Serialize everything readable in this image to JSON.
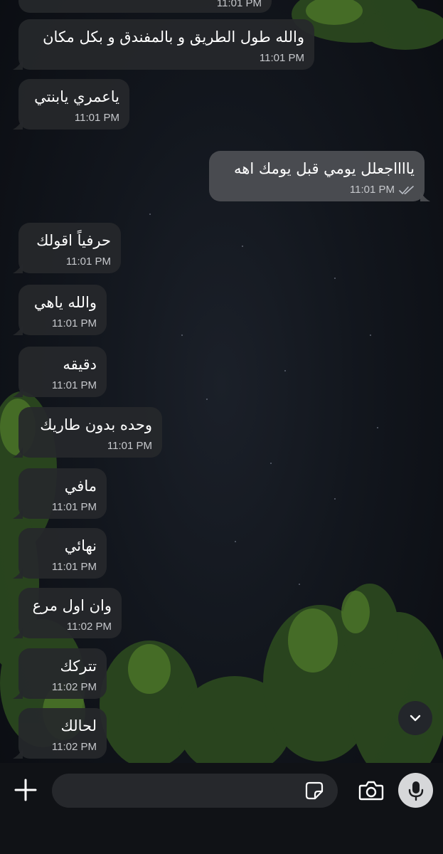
{
  "chat": {
    "top_partial_time": "11:01 PM",
    "messages": [
      {
        "direction": "in",
        "text": "والله طول الطريق و بالمفندق و بكل مكان",
        "time": "11:01 PM"
      },
      {
        "direction": "in",
        "text": "ياعمري يابنتي",
        "time": "11:01 PM"
      },
      {
        "direction": "out",
        "text": "يااااجعلل يومي قبل يومك اهه",
        "time": "11:01 PM",
        "status": "read"
      },
      {
        "direction": "in",
        "text": "حرفياً اقولك",
        "time": "11:01 PM"
      },
      {
        "direction": "in",
        "text": "والله ياهي",
        "time": "11:01 PM"
      },
      {
        "direction": "in",
        "text": "دقيقه",
        "time": "11:01 PM"
      },
      {
        "direction": "in",
        "text": "وحده بدون طاريك",
        "time": "11:01 PM"
      },
      {
        "direction": "in",
        "text": "مافي",
        "time": "11:01 PM"
      },
      {
        "direction": "in",
        "text": "نهائي",
        "time": "11:01 PM"
      },
      {
        "direction": "in",
        "text": "وان اول مرع",
        "time": "11:02 PM"
      },
      {
        "direction": "in",
        "text": "تتركك",
        "time": "11:02 PM"
      },
      {
        "direction": "in",
        "text": "لحالك",
        "time": "11:02 PM"
      }
    ]
  },
  "composer": {
    "input_value": "",
    "icons": {
      "attach": "plus-icon",
      "sticker": "sticker-icon",
      "camera": "camera-icon",
      "mic": "microphone-icon",
      "scroll": "chevron-down-icon"
    }
  },
  "colors": {
    "incoming_bubble": "#26282b",
    "outgoing_bubble": "#4e5054",
    "time_text": "#c6c8cc",
    "read_ticks": "#b8bcc4",
    "mic_button": "#d6d7d9"
  }
}
